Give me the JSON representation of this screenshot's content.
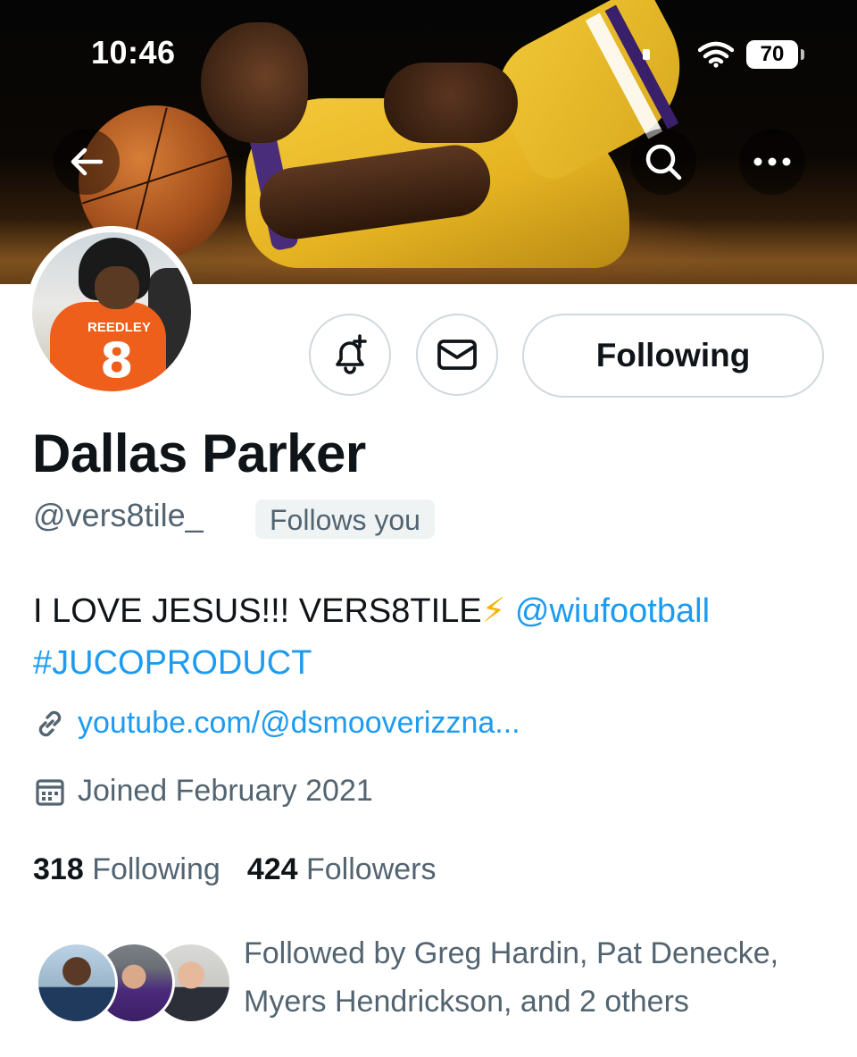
{
  "status_bar": {
    "time": "10:46",
    "battery": "70"
  },
  "banner_nav": {
    "back_icon": "arrow-left-icon",
    "search_icon": "search-icon",
    "more_icon": "more-horizontal-icon"
  },
  "actions": {
    "notify_icon": "bell-plus-icon",
    "message_icon": "envelope-icon",
    "following_label": "Following"
  },
  "profile": {
    "display_name": "Dallas Parker",
    "handle": "@vers8tile_",
    "follows_you": "Follows you",
    "bio_text": "I LOVE JESUS!!! VERS8TILE",
    "bio_emoji": "⚡",
    "bio_mention": "@wiufootball",
    "bio_hashtag": "#JUCOPRODUCT",
    "link": "youtube.com/@dsmooverizzna...",
    "joined": "Joined February 2021",
    "avatar_jersey_name": "REEDLEY",
    "avatar_jersey_number": "8"
  },
  "stats": {
    "following_count": "318",
    "following_label": "Following",
    "followers_count": "424",
    "followers_label": "Followers"
  },
  "followed_by": {
    "text": "Followed by Greg Hardin, Pat Denecke, Myers Hendrickson, and 2 others"
  },
  "colors": {
    "accent": "#1d9bf0",
    "secondary_text": "#536471",
    "border": "#cfd9de",
    "bolt": "#f4b400"
  }
}
